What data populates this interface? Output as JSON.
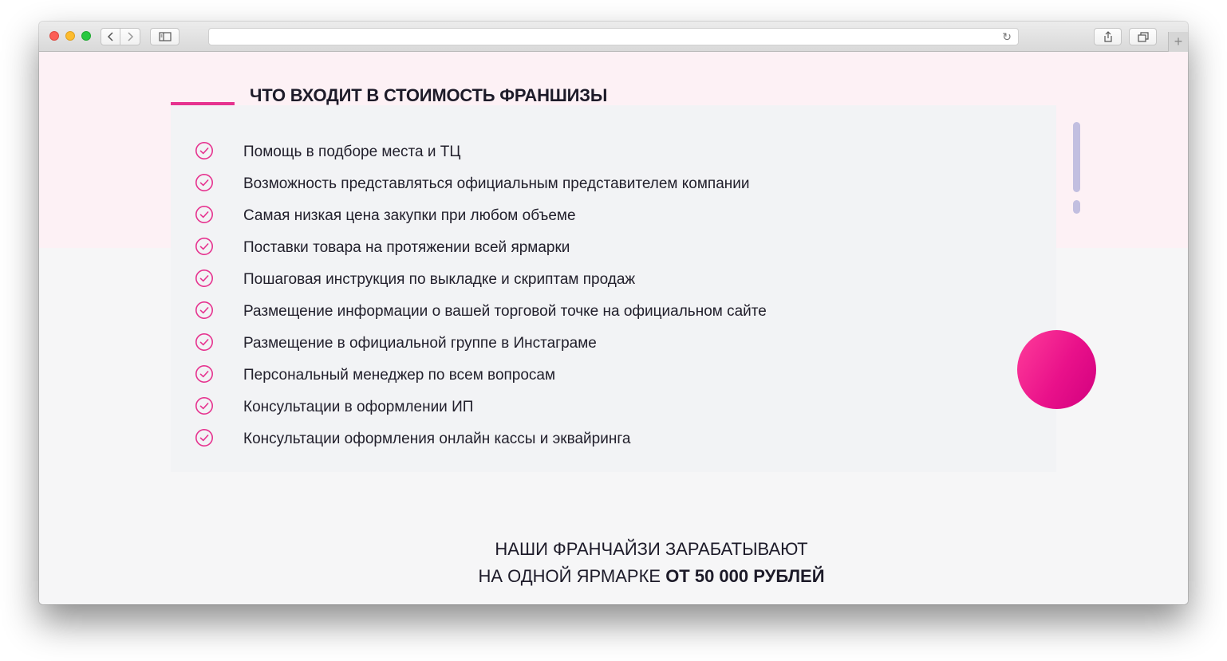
{
  "browser": {
    "address_text": "",
    "icons": {
      "back": "chevron-left-icon",
      "forward": "chevron-right-icon",
      "sidebar": "sidebar-icon",
      "reload": "reload-icon",
      "share": "share-icon",
      "tabs": "tabs-icon",
      "new_tab": "plus-icon"
    }
  },
  "section": {
    "title": "ЧТО ВХОДИТ В СТОИМОСТЬ ФРАНШИЗЫ",
    "items": [
      "Помощь в подборе места и ТЦ",
      "Возможность представляться официальным представителем компании",
      "Самая низкая цена закупки при любом объеме",
      "Поставки товара на протяжении всей ярмарки",
      "Пошаговая инструкция по выкладке и скриптам продаж",
      "Размещение информации о вашей торговой точке на официальном сайте",
      "Размещение в официальной группе в Инстаграме",
      "Персональный менеджер по всем вопросам",
      "Консультации в оформлении ИП",
      "Консультации оформления онлайн кассы и эквайринга"
    ]
  },
  "earnings": {
    "line1": "НАШИ ФРАНЧАЙЗИ ЗАРАБАТЫВАЮТ",
    "line2_prefix": "НА ОДНОЙ ЯРМАРКЕ ",
    "line2_bold": "ОТ 50 000 РУБЛЕЙ"
  },
  "colors": {
    "accent": "#e6338f",
    "pink_band": "#fdf1f5",
    "card": "#f2f3f5",
    "scroll": "#c2bfe0",
    "text": "#1d1b29"
  }
}
